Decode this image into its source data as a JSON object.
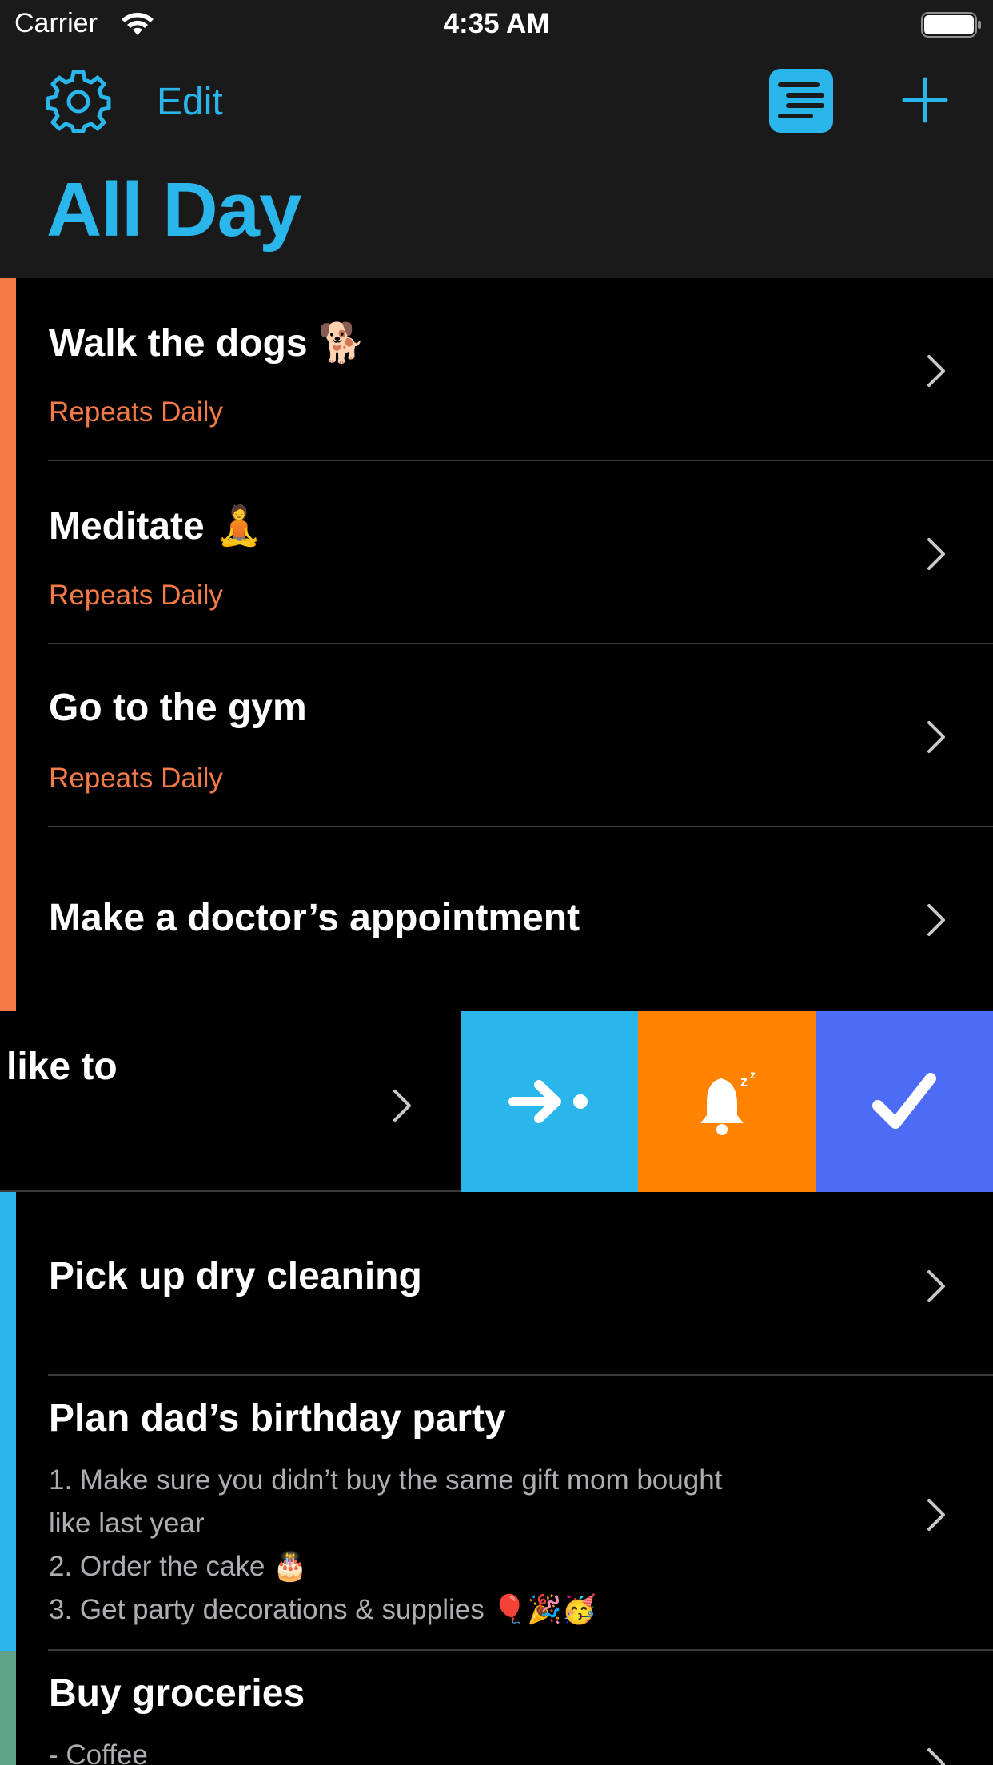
{
  "status_bar": {
    "carrier": "Carrier",
    "time": "4:35 AM"
  },
  "nav": {
    "edit_label": "Edit"
  },
  "page_title": "All Day",
  "colors": {
    "accent": "#2AB5EB",
    "repeat_text": "#F47B48",
    "stripe_orange": "#F47B48",
    "stripe_blue": "#2AB5EB",
    "stripe_green": "#5FA48A",
    "move_action": "#2AB5EB",
    "snooze_action": "#FF8300",
    "done_action": "#4D6CF6"
  },
  "icons": {
    "settings": "gear-icon",
    "list_view": "list-icon",
    "add": "plus-icon",
    "move": "arrow-right-icon",
    "snooze": "bell-snooze-icon",
    "done": "checkmark-icon",
    "disclosure": "chevron-right-icon"
  },
  "tasks": [
    {
      "title": "Walk the dogs 🐕",
      "subtitle": "Repeats Daily"
    },
    {
      "title": "Meditate 🧘",
      "subtitle": "Repeats Daily"
    },
    {
      "title": "Go to the gym",
      "subtitle": "Repeats Daily"
    },
    {
      "title": "Make a doctor’s appointment"
    },
    {
      "title": "like to"
    },
    {
      "title": "Pick up dry cleaning"
    },
    {
      "title": "Plan dad’s birthday party",
      "notes": "1. Make sure you didn’t buy the same gift mom bought\nlike last year\n2. Order the cake 🎂\n3. Get party decorations & supplies 🎈🎉🥳"
    },
    {
      "title": "Buy groceries",
      "notes": "- Coffee"
    }
  ]
}
